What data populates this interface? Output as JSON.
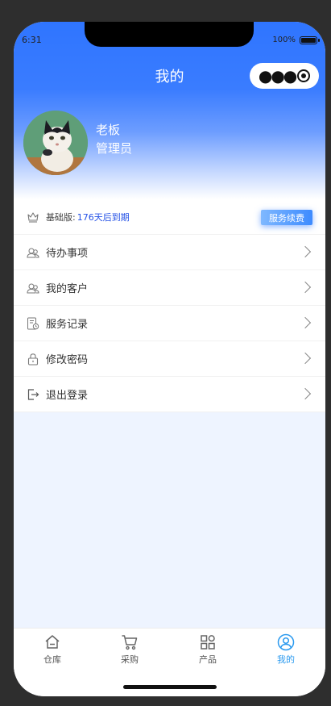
{
  "status": {
    "time": "6:31",
    "battery": "100%"
  },
  "nav": {
    "title": "我的",
    "capsule_more_icon": "more-dots-icon",
    "capsule_close_icon": "target-close-icon"
  },
  "profile": {
    "name": "老板",
    "role": "管理员",
    "avatar_icon": "cat-avatar"
  },
  "plan": {
    "label": "基础版: ",
    "expire": "176天后到期",
    "renew_button": "服务续费",
    "icon": "crown-icon"
  },
  "menu": [
    {
      "label": "待办事项",
      "icon": "users-icon"
    },
    {
      "label": "我的客户",
      "icon": "users-icon"
    },
    {
      "label": "服务记录",
      "icon": "record-clock-icon"
    },
    {
      "label": "修改密码",
      "icon": "lock-icon"
    },
    {
      "label": "退出登录",
      "icon": "logout-icon"
    }
  ],
  "tabbar": [
    {
      "label": "仓库",
      "icon": "home-icon",
      "active": false
    },
    {
      "label": "采购",
      "icon": "cart-icon",
      "active": false
    },
    {
      "label": "产品",
      "icon": "grid-icon",
      "active": false
    },
    {
      "label": "我的",
      "icon": "user-circle-icon",
      "active": true
    }
  ],
  "colors": {
    "primary": "#2f75ff",
    "tab_active": "#2b9aef",
    "expire_text": "#2451e6",
    "page_bg": "#eef4ff"
  }
}
